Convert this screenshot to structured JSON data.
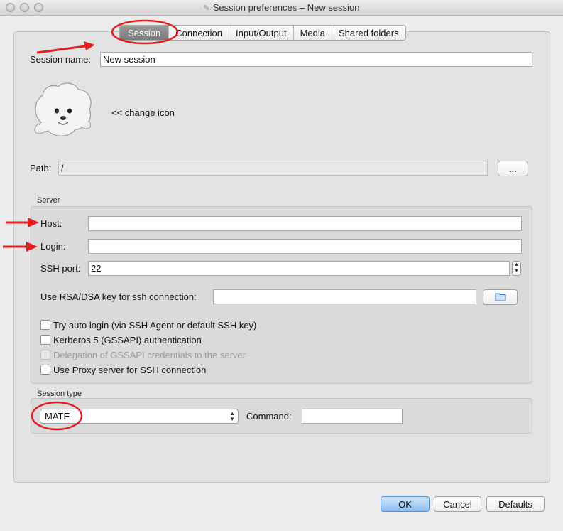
{
  "window": {
    "title": "Session preferences – New session"
  },
  "tabs": [
    {
      "label": "Session",
      "active": true
    },
    {
      "label": "Connection",
      "active": false
    },
    {
      "label": "Input/Output",
      "active": false
    },
    {
      "label": "Media",
      "active": false
    },
    {
      "label": "Shared folders",
      "active": false
    }
  ],
  "session": {
    "name_label": "Session name:",
    "name_value": "New session",
    "change_icon_label": "<< change icon",
    "path_label": "Path:",
    "path_value": "/",
    "path_browse": "..."
  },
  "server": {
    "group_label": "Server",
    "host_label": "Host:",
    "host_value": "",
    "login_label": "Login:",
    "login_value": "",
    "ssh_port_label": "SSH port:",
    "ssh_port_value": "22",
    "rsa_label": "Use RSA/DSA key for ssh connection:",
    "rsa_value": "",
    "checkboxes": [
      {
        "label": "Try auto login (via SSH Agent or default SSH key)",
        "checked": false,
        "enabled": true
      },
      {
        "label": "Kerberos 5 (GSSAPI) authentication",
        "checked": false,
        "enabled": true
      },
      {
        "label": "Delegation of GSSAPI credentials to the server",
        "checked": false,
        "enabled": false
      },
      {
        "label": "Use Proxy server for SSH connection",
        "checked": false,
        "enabled": true
      }
    ]
  },
  "session_type": {
    "group_label": "Session type",
    "selected": "MATE",
    "command_label": "Command:",
    "command_value": ""
  },
  "buttons": {
    "ok": "OK",
    "cancel": "Cancel",
    "defaults": "Defaults"
  },
  "colors": {
    "annotation": "#e02020",
    "accent": "#8ec0f2"
  },
  "icons": {
    "app_icon": "seal-icon",
    "folder": "folder-icon",
    "document": "document-icon"
  }
}
